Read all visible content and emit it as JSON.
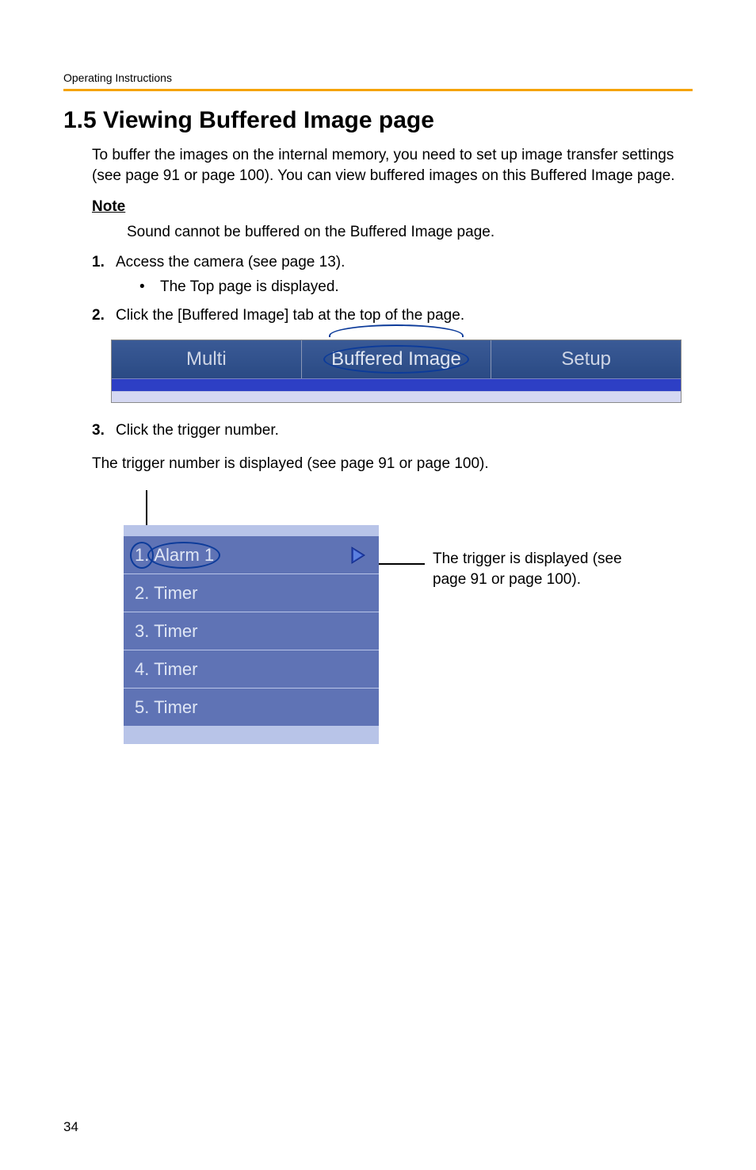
{
  "header": {
    "running": "Operating Instructions"
  },
  "title": "1.5   Viewing Buffered Image page",
  "intro": "To buffer the images on the internal memory, you need to set up image transfer settings (see page 91 or page 100). You can view buffered images on this Buffered Image page.",
  "note": {
    "heading": "Note",
    "text": "Sound cannot be buffered on the Buffered Image page."
  },
  "steps": [
    {
      "num": "1.",
      "text": "Access the camera (see page 13).",
      "sub": "The Top page is displayed."
    },
    {
      "num": "2.",
      "text": "Click the [Buffered Image] tab at the top of the page."
    },
    {
      "num": "3.",
      "text": "Click the trigger number."
    }
  ],
  "tabs": {
    "multi": "Multi",
    "buffered": "Buffered Image",
    "setup": "Setup"
  },
  "step3_desc": "The trigger number is displayed (see page 91 or page 100).",
  "triggerList": {
    "row1_num": "1.",
    "row1_label": "Alarm 1",
    "rows": [
      "2. Timer",
      "3. Timer",
      "4. Timer",
      "5. Timer"
    ]
  },
  "callout": "The trigger is displayed (see page 91 or page 100).",
  "pageNumber": "34"
}
